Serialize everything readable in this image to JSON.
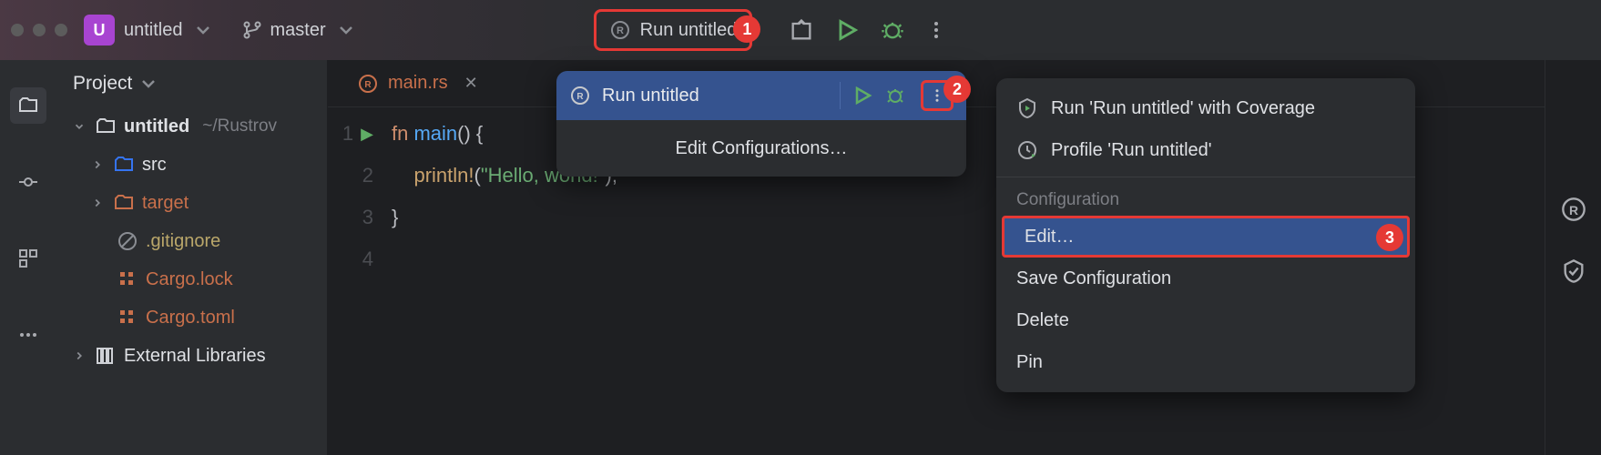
{
  "topbar": {
    "project_badge": "U",
    "project_name": "untitled",
    "branch": "master",
    "run_config": "Run untitled",
    "marker1": "1"
  },
  "sidebar": {
    "title": "Project",
    "root": {
      "name": "untitled",
      "path": "~/Rustrov"
    },
    "items": [
      {
        "name": "src",
        "type": "folder-blue"
      },
      {
        "name": "target",
        "type": "folder-orange"
      },
      {
        "name": ".gitignore",
        "type": "ignored"
      },
      {
        "name": "Cargo.lock",
        "type": "cargo"
      },
      {
        "name": "Cargo.toml",
        "type": "cargo"
      }
    ],
    "external": "External Libraries"
  },
  "editor": {
    "tab": "main.rs",
    "lines": [
      "1",
      "2",
      "3",
      "4"
    ],
    "code": {
      "l1_kw": "fn ",
      "l1_fn": "main",
      "l1_rest": "() {",
      "l2_indent": "    ",
      "l2_mac": "println!",
      "l2_paren": "(",
      "l2_str": "\"Hello, world!\"",
      "l2_end": ");",
      "l3": "}"
    }
  },
  "popup1": {
    "label": "Run untitled",
    "edit": "Edit Configurations…",
    "marker2": "2"
  },
  "popup2": {
    "coverage": "Run 'Run untitled' with Coverage",
    "profile": "Profile 'Run untitled'",
    "section": "Configuration",
    "edit": "Edit…",
    "save": "Save Configuration",
    "delete": "Delete",
    "pin": "Pin",
    "marker3": "3"
  }
}
